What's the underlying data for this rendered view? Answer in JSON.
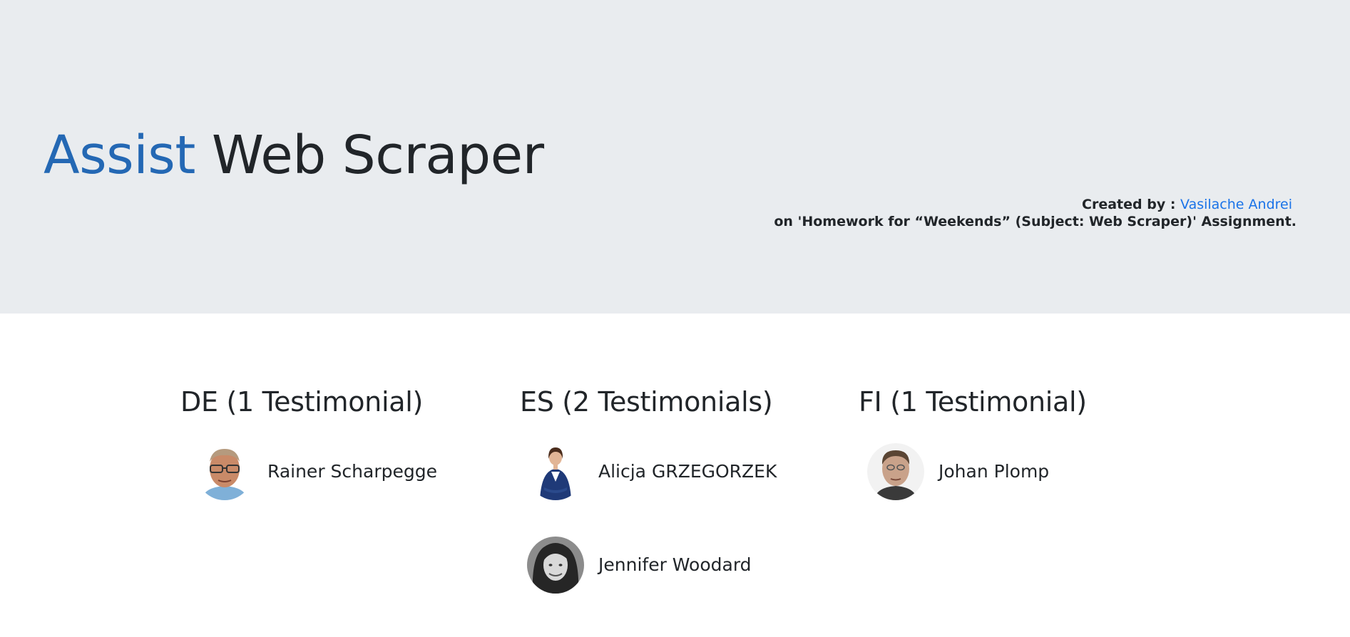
{
  "header": {
    "title_accent": "Assist",
    "title_rest": "Web Scraper",
    "credit_prefix": "Created by :",
    "credit_author": "Vasilache Andrei",
    "credit_line2": "on 'Homework for “Weekends” (Subject: Web Scraper)' Assignment.",
    "accent_color": "#2468b4",
    "link_color": "#1a73e8",
    "hero_bg": "#e9ecef"
  },
  "groups": [
    {
      "heading": "DE (1 Testimonial)",
      "people": [
        {
          "name": "Rainer Scharpegge",
          "avatar": "man-glasses-avatar"
        }
      ]
    },
    {
      "heading": "ES (2 Testimonials)",
      "people": [
        {
          "name": "Alicja GRZEGORZEK",
          "avatar": "woman-suit-avatar"
        },
        {
          "name": "Jennifer Woodard",
          "avatar": "woman-bw-avatar"
        }
      ]
    },
    {
      "heading": "FI (1 Testimonial)",
      "people": [
        {
          "name": "Johan Plomp",
          "avatar": "man-avatar"
        }
      ]
    }
  ]
}
